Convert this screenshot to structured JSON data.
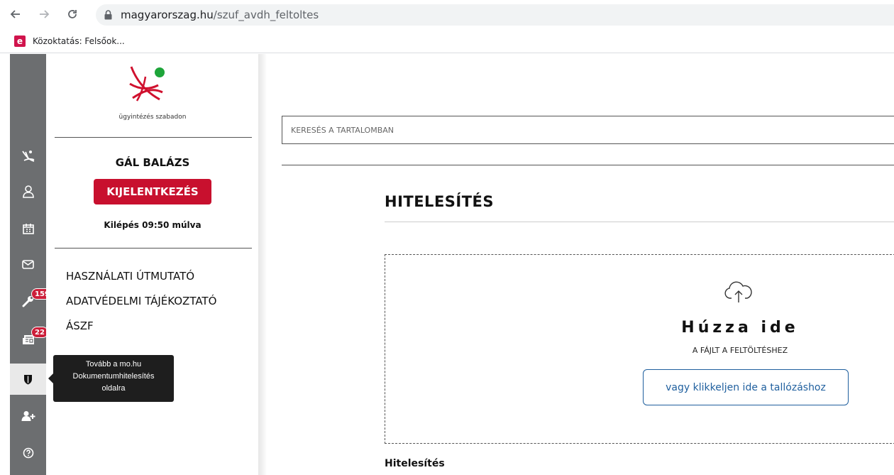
{
  "browser": {
    "url_host": "magyarorszag.hu",
    "url_path": "/szuf_avdh_feltoltes",
    "bookmark_icon_letter": "e",
    "bookmark_label": "Közoktatás: Felsőok..."
  },
  "sidebar": {
    "logo_caption": "ügyintézés szabadon",
    "user_name": "GÁL BALÁZS",
    "logout_label": "KIJELENTKEZÉS",
    "session_text": "Kilépés 09:50 múlva",
    "links": [
      {
        "label": "HASZNÁLATI ÚTMUTATÓ"
      },
      {
        "label": "ADATVÉDELMI TÁJÉKOZTATÓ"
      },
      {
        "label": "ÁSZF"
      }
    ]
  },
  "rail": {
    "items": [
      {
        "icon": "logo-icon"
      },
      {
        "icon": "user-icon"
      },
      {
        "icon": "calendar-icon"
      },
      {
        "icon": "mail-icon"
      },
      {
        "icon": "wrench-icon",
        "badge": "159"
      },
      {
        "icon": "newspaper-icon",
        "badge": "22"
      },
      {
        "icon": "shield-icon",
        "active": true
      },
      {
        "icon": "add-user-icon"
      },
      {
        "icon": "help-icon"
      }
    ],
    "tooltip_lines": [
      "Tovább a mo.hu",
      "Dokumentumhitelesítés",
      "oldalra"
    ]
  },
  "main": {
    "search_placeholder": "KERESÉS A TARTALOMBAN",
    "page_title": "HITELESÍTÉS",
    "dropzone": {
      "title": "Húzza ide",
      "subtitle": "A FÁJLT A FELTÖLTÉSHEZ",
      "browse_label": "vagy klikkeljen ide a tallózáshoz"
    },
    "section_label": "Hitelesítés"
  },
  "colors": {
    "accent_red": "#c8102e",
    "rail_gray": "#6c6e70",
    "link_blue": "#1f5f9e",
    "logo_green": "#1ea53a"
  }
}
